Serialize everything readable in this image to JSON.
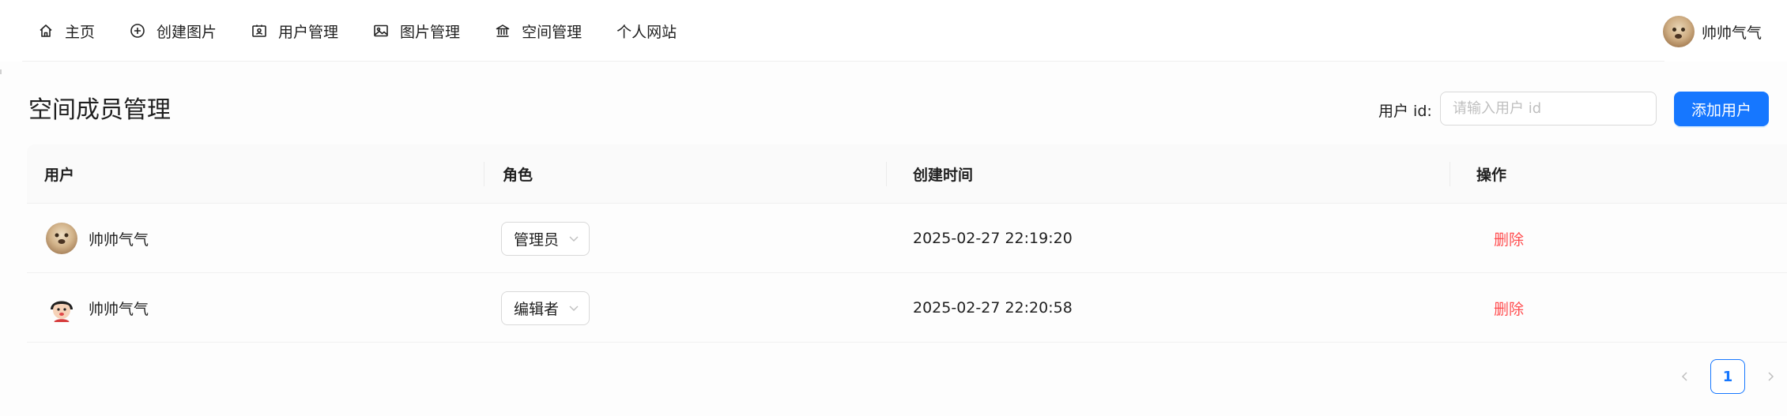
{
  "nav": {
    "items": [
      {
        "label": "主页",
        "icon": "home-icon"
      },
      {
        "label": "创建图片",
        "icon": "plus-circle-icon"
      },
      {
        "label": "用户管理",
        "icon": "idcard-icon"
      },
      {
        "label": "图片管理",
        "icon": "picture-icon"
      },
      {
        "label": "空间管理",
        "icon": "bank-icon"
      },
      {
        "label": "个人网站",
        "icon": ""
      }
    ],
    "user": {
      "name": "帅帅气气",
      "avatar": "dog-avatar"
    }
  },
  "page": {
    "title": "空间成员管理",
    "search_label": "用户 id:",
    "search_placeholder": "请输入用户 id",
    "search_value": "",
    "add_button": "添加用户"
  },
  "table": {
    "columns": [
      "用户",
      "角色",
      "创建时间",
      "操作"
    ],
    "rows": [
      {
        "user": "帅帅气气",
        "avatar": "dog-avatar",
        "role": "管理员",
        "created": "2025-02-27 22:19:20",
        "action": "删除"
      },
      {
        "user": "帅帅气气",
        "avatar": "cartoon-avatar",
        "role": "编辑者",
        "created": "2025-02-27 22:20:58",
        "action": "删除"
      }
    ]
  },
  "pagination": {
    "current": "1"
  },
  "colors": {
    "primary": "#1677ff",
    "danger": "#ff4d4f",
    "header_bg": "#fafafa",
    "border": "#d9d9d9"
  }
}
